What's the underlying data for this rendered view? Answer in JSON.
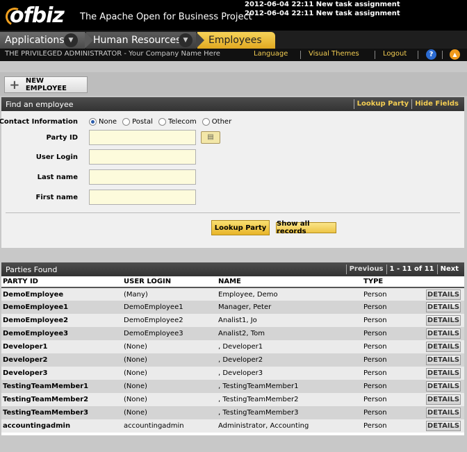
{
  "header": {
    "logo_text": "ofbiz",
    "project_title": "The Apache Open for Business Project",
    "notices": [
      "2012-06-04 22:11 New task assignment",
      "2012-06-04 22:11 New task assignment"
    ]
  },
  "nav": {
    "applications": "Applications",
    "human_resources": "Human Resources",
    "employees": "Employees"
  },
  "userbar": {
    "user": "THE PRIVILEGED ADMINISTRATOR - Your Company Name Here",
    "language": "Language",
    "visual_themes": "Visual Themes",
    "logout": "Logout",
    "help": "?",
    "collapse": "▲"
  },
  "toolbar": {
    "new_employee": "NEW EMPLOYEE"
  },
  "find": {
    "title": "Find an employee",
    "lookup_party_link": "Lookup Party",
    "hide_fields_link": "Hide Fields",
    "contact_info_label": "Contact Information",
    "radio_options": [
      "None",
      "Postal",
      "Telecom",
      "Other"
    ],
    "selected_option": "None",
    "party_id_label": "Party ID",
    "user_login_label": "User Login",
    "last_name_label": "Last name",
    "first_name_label": "First name",
    "lookup_button": "Lookup Party",
    "show_all_button": "Show all records"
  },
  "results": {
    "title": "Parties Found",
    "previous": "Previous",
    "range": "1 - 11 of 11",
    "next": "Next",
    "columns": [
      "PARTY ID",
      "USER LOGIN",
      "NAME",
      "TYPE"
    ],
    "details_label": "DETAILS",
    "rows": [
      {
        "party_id": "DemoEmployee",
        "login": "(Many)",
        "name": "Employee, Demo",
        "type": "Person"
      },
      {
        "party_id": "DemoEmployee1",
        "login": "DemoEmployee1",
        "name": "Manager, Peter",
        "type": "Person"
      },
      {
        "party_id": "DemoEmployee2",
        "login": "DemoEmployee2",
        "name": "Analist1, Jo",
        "type": "Person"
      },
      {
        "party_id": "DemoEmployee3",
        "login": "DemoEmployee3",
        "name": "Analist2, Tom",
        "type": "Person"
      },
      {
        "party_id": "Developer1",
        "login": "(None)",
        "name": ", Developer1",
        "type": "Person"
      },
      {
        "party_id": "Developer2",
        "login": "(None)",
        "name": ", Developer2",
        "type": "Person"
      },
      {
        "party_id": "Developer3",
        "login": "(None)",
        "name": ", Developer3",
        "type": "Person"
      },
      {
        "party_id": "TestingTeamMember1",
        "login": "(None)",
        "name": ", TestingTeamMember1",
        "type": "Person"
      },
      {
        "party_id": "TestingTeamMember2",
        "login": "(None)",
        "name": ", TestingTeamMember2",
        "type": "Person"
      },
      {
        "party_id": "TestingTeamMember3",
        "login": "(None)",
        "name": ", TestingTeamMember3",
        "type": "Person"
      },
      {
        "party_id": "accountingadmin",
        "login": "accountingadmin",
        "name": "Administrator, Accounting",
        "type": "Person"
      }
    ]
  }
}
